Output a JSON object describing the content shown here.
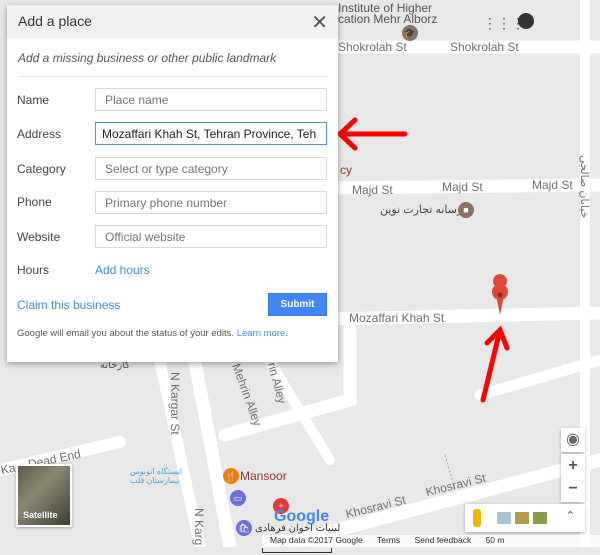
{
  "dialog": {
    "title": "Add a place",
    "subtitle": "Add a missing business or other public landmark",
    "fields": [
      {
        "label": "Name",
        "placeholder": "Place name",
        "value": ""
      },
      {
        "label": "Address",
        "placeholder": "",
        "value": "Mozaffari Khah St, Tehran Province, Tehran"
      },
      {
        "label": "Category",
        "placeholder": "Select or type category",
        "value": ""
      },
      {
        "label": "Phone",
        "placeholder": "Primary phone number",
        "value": ""
      },
      {
        "label": "Website",
        "placeholder": "Official website",
        "value": ""
      }
    ],
    "hours_label": "Hours",
    "add_hours": "Add hours",
    "claim": "Claim this business",
    "submit": "Submit",
    "footer": "Google will email you about the status of your edits.",
    "learn_more": "Learn more."
  },
  "map": {
    "labels": {
      "institute1": "Institute of Higher",
      "institute2": "cation Mehr Alborz",
      "shokrolah1": "Shokrolah St",
      "shokrolah2": "Shokrolah St",
      "majd1": "Majd St",
      "majd2": "Majd St",
      "majd3": "Majd St",
      "resane": "رسانه تجارت نوین",
      "mozaffari": "Mozaffari Khah St",
      "cy": "cy",
      "kargar1": "N Kargar St",
      "kargar2": "N Karg",
      "alley1": "Mehrin Alley",
      "alley2": "rin Alley",
      "deadend": "Ka... Dead End",
      "mansoor": "Mansoor",
      "bus": "ایستگاه اتوبوس بیمارستان قلب",
      "farhadi": "لبنیات اخوان فرهادی",
      "khosravi1": "Khosravi St",
      "khosravi2": "Khosravi St",
      "salehi": "خیابان صالحی",
      "karkhane": "کارخانه"
    },
    "satellite": "Satellite",
    "logo": "Google",
    "attribution": {
      "data": "Map data ©2017 Google",
      "terms": "Terms",
      "feedback": "Send feedback",
      "scale": "50 m"
    },
    "colors": {
      "marker": "#e0463a",
      "arrow": "#ff0000",
      "accent": "#4285f4"
    }
  }
}
